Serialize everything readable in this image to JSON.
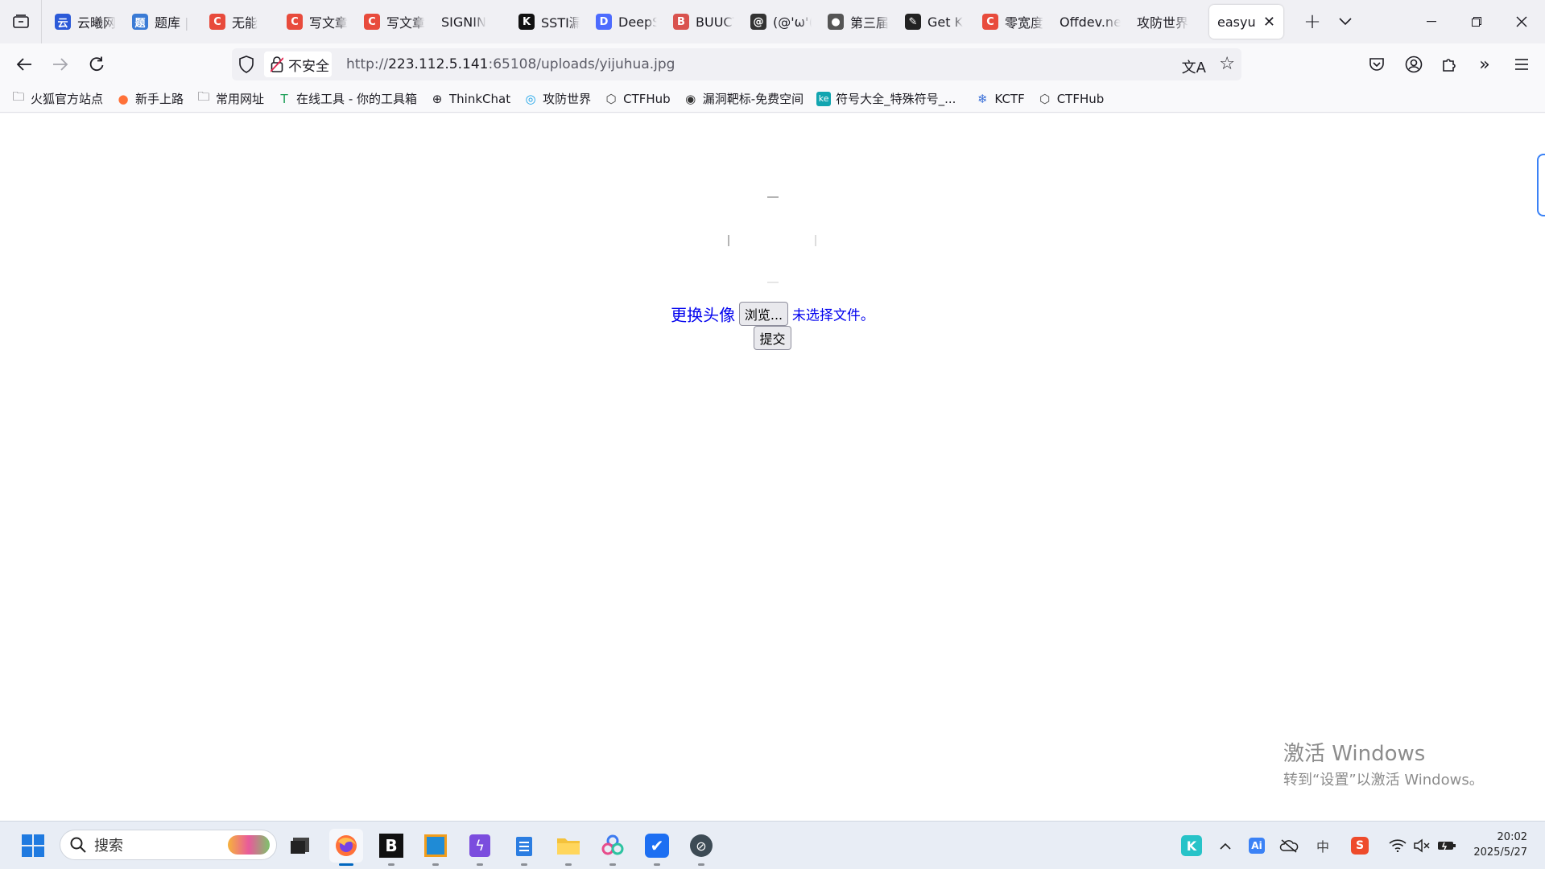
{
  "tabs": [
    {
      "title": "云曦网",
      "color": "#2c5ad8",
      "glyph": "云"
    },
    {
      "title": "题库 |",
      "color": "#3a7bd5",
      "glyph": "题"
    },
    {
      "title": "无能",
      "color": "#e84b3c",
      "glyph": "C"
    },
    {
      "title": "写文章",
      "color": "#e84b3c",
      "glyph": "C"
    },
    {
      "title": "写文章",
      "color": "#e84b3c",
      "glyph": "C"
    },
    {
      "title": "SIGNIN",
      "color": "transparent",
      "glyph": ""
    },
    {
      "title": "SSTI漏",
      "color": "#111111",
      "glyph": "K"
    },
    {
      "title": "DeepSeek",
      "color": "#4d6bfe",
      "glyph": "D"
    },
    {
      "title": "BUUCTF",
      "color": "#d9534f",
      "glyph": "B"
    },
    {
      "title": "(@'ω'(",
      "color": "#333333",
      "glyph": "@"
    },
    {
      "title": "第三届",
      "color": "#555555",
      "glyph": "●"
    },
    {
      "title": "Get K",
      "color": "#222222",
      "glyph": "✎"
    },
    {
      "title": "零宽度",
      "color": "#e84b3c",
      "glyph": "C"
    },
    {
      "title": "Offdev.net",
      "color": "transparent",
      "glyph": ""
    },
    {
      "title": "攻防世界",
      "color": "transparent",
      "glyph": ""
    }
  ],
  "active_tab": {
    "title": "easyupload"
  },
  "nav": {
    "identity_label": "不安全",
    "url_prefix": "http://",
    "url_host": "223.112.5.141",
    "url_rest": ":65108/uploads/yijuhua.jpg"
  },
  "bookmarks": [
    {
      "label": "火狐官方站点",
      "icon": "folder-icon"
    },
    {
      "label": "新手上路",
      "icon": "firefox-icon"
    },
    {
      "label": "常用网址",
      "icon": "folder-icon"
    },
    {
      "label": "在线工具 - 你的工具箱",
      "icon": "tool-icon"
    },
    {
      "label": "ThinkChat",
      "icon": "globe-icon"
    },
    {
      "label": "攻防世界",
      "icon": "site-icon"
    },
    {
      "label": "CTFHub",
      "icon": "cube-icon"
    },
    {
      "label": "漏洞靶标-免费空间",
      "icon": "target-icon"
    },
    {
      "label": "符号大全_特殊符号_...",
      "icon": "ke-icon"
    },
    {
      "label": "KCTF",
      "icon": "snowflake-icon"
    },
    {
      "label": "CTFHub",
      "icon": "cube-icon"
    }
  ],
  "page": {
    "change_avatar_label": "更换头像",
    "browse_button": "浏览...",
    "no_file_text": "未选择文件。",
    "submit_button": "提交"
  },
  "watermark": {
    "line1": "激活 Windows",
    "line2": "转到“设置”以激活 Windows。"
  },
  "taskbar": {
    "search_placeholder": "搜索",
    "time": "20:02",
    "date": "2025/5/27",
    "ime": "中"
  },
  "colors": {
    "accent": "#0060df",
    "link_blue": "#0000ee",
    "tab_strip_bg": "#f0f0f4"
  }
}
